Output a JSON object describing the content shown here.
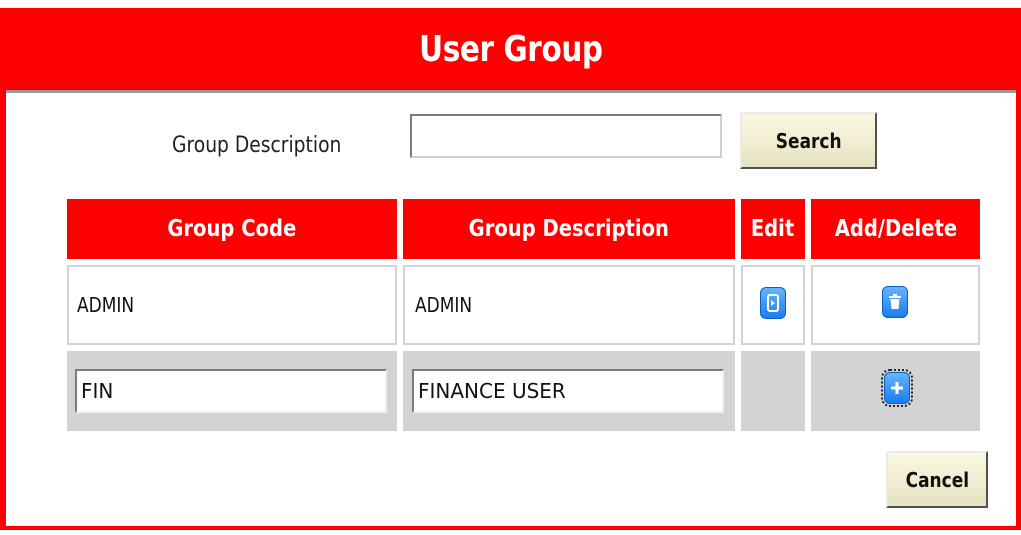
{
  "title": "User Group",
  "search": {
    "label": "Group Description",
    "value": "",
    "button_label": "Search"
  },
  "table": {
    "headers": [
      "Group Code",
      "Group Description",
      "Edit",
      "Add/Delete"
    ],
    "rows": [
      {
        "code": "ADMIN",
        "description": "ADMIN",
        "edit_icon": "edit-icon",
        "action_icon": "trash-icon"
      }
    ],
    "new_row": {
      "code": "FIN",
      "description": "FINANCE USER",
      "action_icon": "plus-icon"
    }
  },
  "footer": {
    "cancel_label": "Cancel"
  },
  "colors": {
    "accent": "#ff0000",
    "button_bg": "#f2efd0",
    "icon_blue": "#2a8cf5",
    "row_gray": "#d3d3d3"
  }
}
